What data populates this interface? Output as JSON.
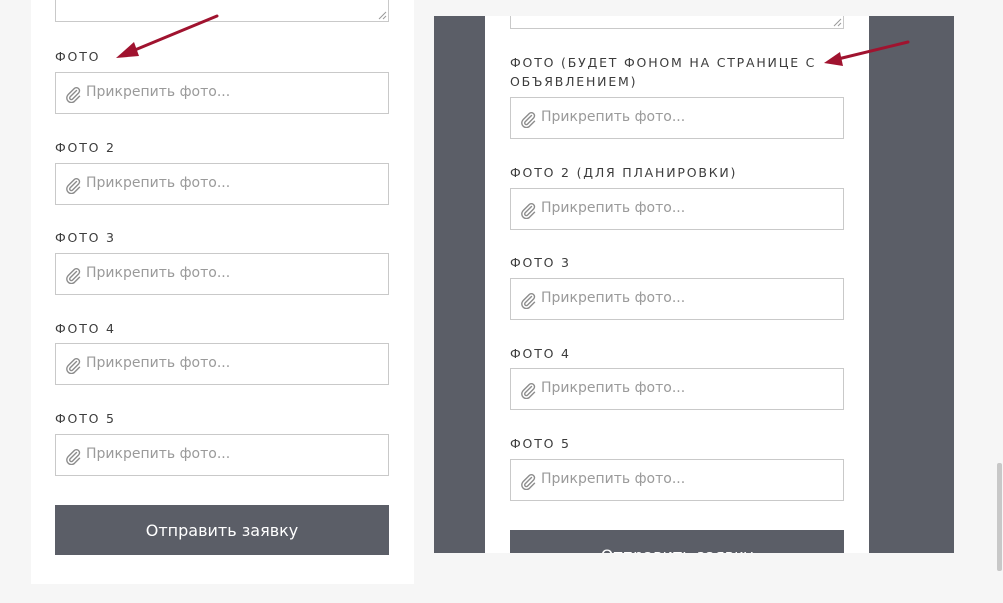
{
  "left_form": {
    "fields": [
      {
        "label": "ФОТО",
        "placeholder": "Прикрепить фото..."
      },
      {
        "label": "ФОТО 2",
        "placeholder": "Прикрепить фото..."
      },
      {
        "label": "ФОТО 3",
        "placeholder": "Прикрепить фото..."
      },
      {
        "label": "ФОТО 4",
        "placeholder": "Прикрепить фото..."
      },
      {
        "label": "ФОТО 5",
        "placeholder": "Прикрепить фото..."
      }
    ],
    "submit_label": "Отправить заявку"
  },
  "right_form": {
    "fields": [
      {
        "label_line1": "ФОТО (БУДЕТ ФОНОМ НА СТРАНИЦЕ С",
        "label_line2": "ОБЪЯВЛЕНИЕМ)",
        "placeholder": "Прикрепить фото..."
      },
      {
        "label": "ФОТО 2 (ДЛЯ ПЛАНИРОВКИ)",
        "placeholder": "Прикрепить фото..."
      },
      {
        "label": "ФОТО 3",
        "placeholder": "Прикрепить фото..."
      },
      {
        "label": "ФОТО 4",
        "placeholder": "Прикрепить фото..."
      },
      {
        "label": "ФОТО 5",
        "placeholder": "Прикрепить фото..."
      }
    ],
    "submit_label": "Отправить заявку"
  },
  "icons": {
    "attachment": "paperclip-icon",
    "annotation": "red-arrow"
  },
  "colors": {
    "annotation_arrow": "#a0132f",
    "button_background": "#5b5e67",
    "frame_background": "#5b5e67",
    "page_background": "#f6f6f6"
  }
}
